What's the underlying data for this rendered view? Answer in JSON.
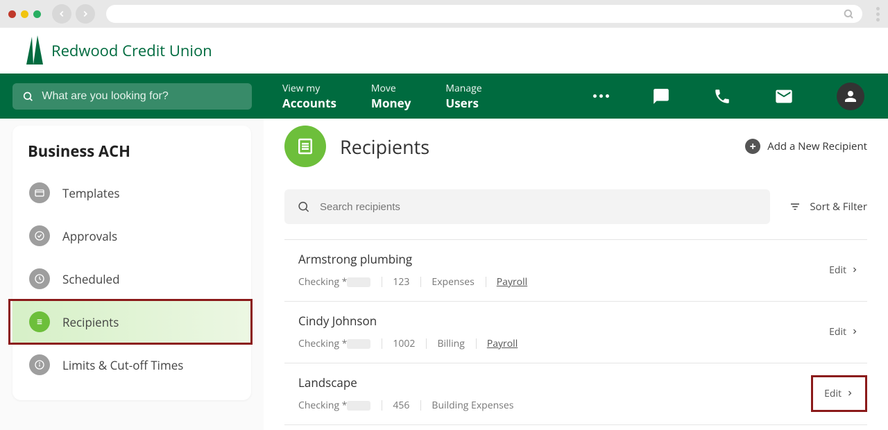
{
  "browser": {
    "search_placeholder": ""
  },
  "logo": {
    "text": "Redwood Credit Union"
  },
  "topnav": {
    "search_placeholder": "What are you looking for?",
    "items": [
      {
        "top": "View my",
        "bottom": "Accounts"
      },
      {
        "top": "Move",
        "bottom": "Money"
      },
      {
        "top": "Manage",
        "bottom": "Users"
      }
    ]
  },
  "sidebar": {
    "title": "Business ACH",
    "items": [
      {
        "label": "Templates"
      },
      {
        "label": "Approvals"
      },
      {
        "label": "Scheduled"
      },
      {
        "label": "Recipients"
      },
      {
        "label": "Limits & Cut-off Times"
      }
    ]
  },
  "page": {
    "title": "Recipients",
    "add_label": "Add a New Recipient",
    "search_placeholder": "Search recipients",
    "sort_label": "Sort & Filter",
    "edit_label": "Edit"
  },
  "recipients": [
    {
      "name": "Armstrong plumbing",
      "acct_type": "Checking *",
      "routing": "123",
      "cat1": "Expenses",
      "cat2": "Payroll"
    },
    {
      "name": "Cindy Johnson",
      "acct_type": "Checking *",
      "routing": "1002",
      "cat1": "Billing",
      "cat2": "Payroll"
    },
    {
      "name": "Landscape",
      "acct_type": "Checking *",
      "routing": "456",
      "cat1": "Building Expenses",
      "cat2": ""
    }
  ]
}
